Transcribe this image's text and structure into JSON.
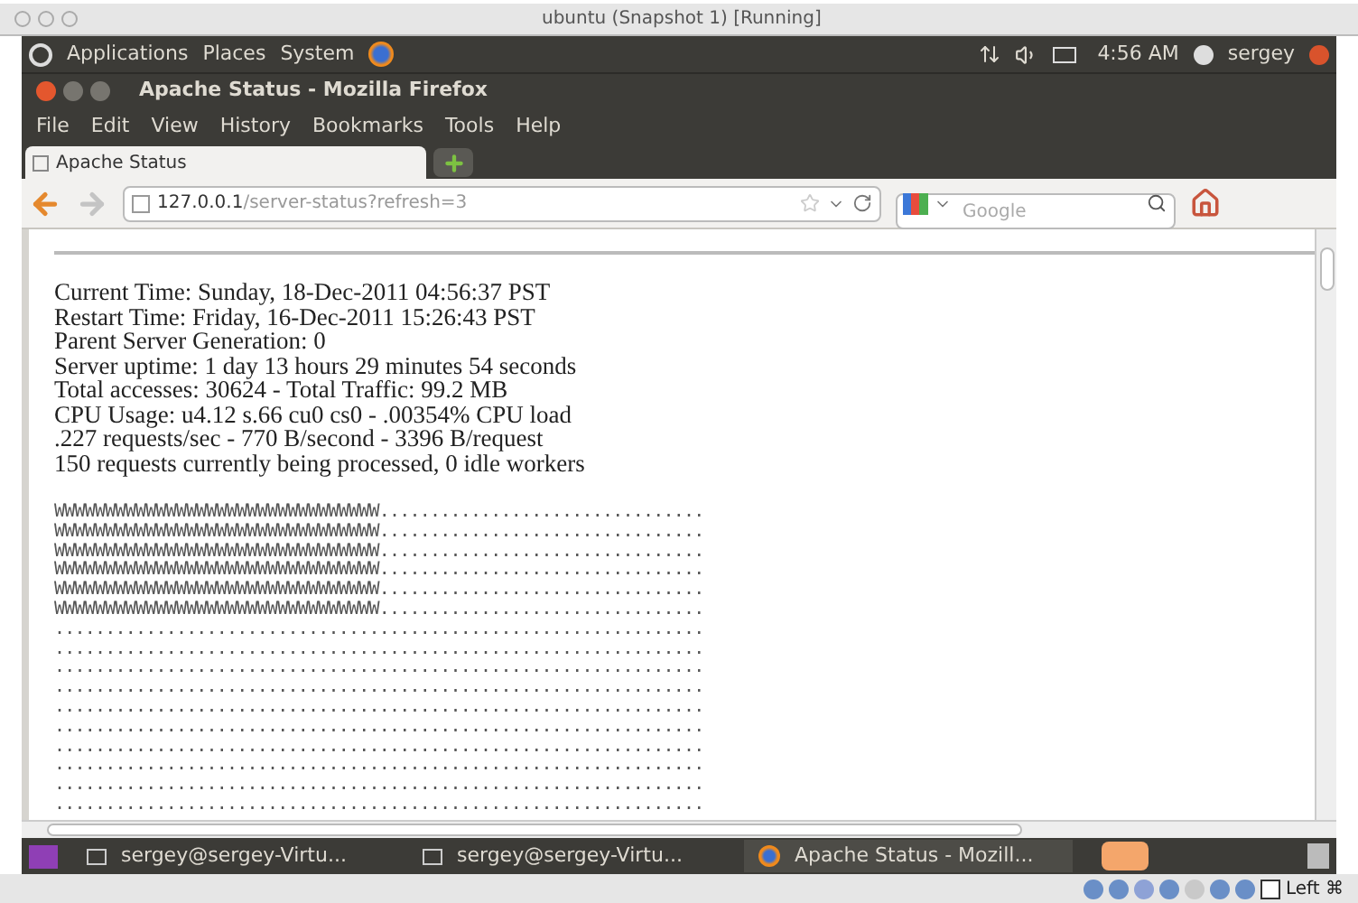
{
  "host_window": {
    "title": "ubuntu (Snapshot 1) [Running]"
  },
  "top_panel": {
    "menus": [
      "Applications",
      "Places",
      "System"
    ],
    "clock": "4:56 AM",
    "user": "sergey"
  },
  "browser_window": {
    "title": "Apache Status - Mozilla Firefox"
  },
  "menu_bar": [
    {
      "label": "File"
    },
    {
      "label": "Edit"
    },
    {
      "label": "View"
    },
    {
      "label": "History"
    },
    {
      "label": "Bookmarks"
    },
    {
      "label": "Tools"
    },
    {
      "label": "Help"
    }
  ],
  "tabs": [
    {
      "label": "Apache Status",
      "selected": true
    }
  ],
  "address_bar": {
    "host": "127.0.0.1",
    "path": "/server-status?refresh=3"
  },
  "search_field": {
    "placeholder": "Google"
  },
  "status_lines": [
    "Current Time: Sunday, 18-Dec-2011 04:56:37 PST",
    "Restart Time: Friday, 16-Dec-2011 15:26:43 PST",
    "Parent Server Generation: 0",
    "Server uptime: 1 day 13 hours 29 minutes 54 seconds",
    "Total accesses: 30624 - Total Traffic: 99.2 MB",
    "CPU Usage: u4.12 s.66 cu0 cs0 - .00354% CPU load",
    ".227 requests/sec - 770 B/second - 3396 B/request",
    "150 requests currently being processed, 0 idle workers"
  ],
  "scoreboard": [
    "WWWWWWWWWWWWWWWWWWWWWWWWWWWWWWWW................................",
    "WWWWWWWWWWWWWWWWWWWWWWWWWWWWWWWW................................",
    "WWWWWWWWWWWWWWWWWWWWWWWWWWWWWWWW................................",
    "WWWWWWWWWWWWWWWWWWWWWWWWWWWWWWWW................................",
    "WWWWWWWWWWWWWWWWWWWWWWWWWWWWWWWW................................",
    "WWWWWWWWWWWWWWWWWWWWWWWWWWWWWWWW................................",
    "................................................................",
    "................................................................",
    "................................................................",
    "................................................................",
    "................................................................",
    "................................................................",
    "................................................................",
    "................................................................",
    "................................................................",
    "................................................................"
  ],
  "taskbar": [
    {
      "label": "sergey@sergey-Virtu...",
      "kind": "terminal",
      "selected": false
    },
    {
      "label": "sergey@sergey-Virtu...",
      "kind": "terminal",
      "selected": false
    },
    {
      "label": "Apache Status - Mozill...",
      "kind": "browser",
      "selected": true
    }
  ],
  "host_status": {
    "host_key": "Left ⌘"
  }
}
